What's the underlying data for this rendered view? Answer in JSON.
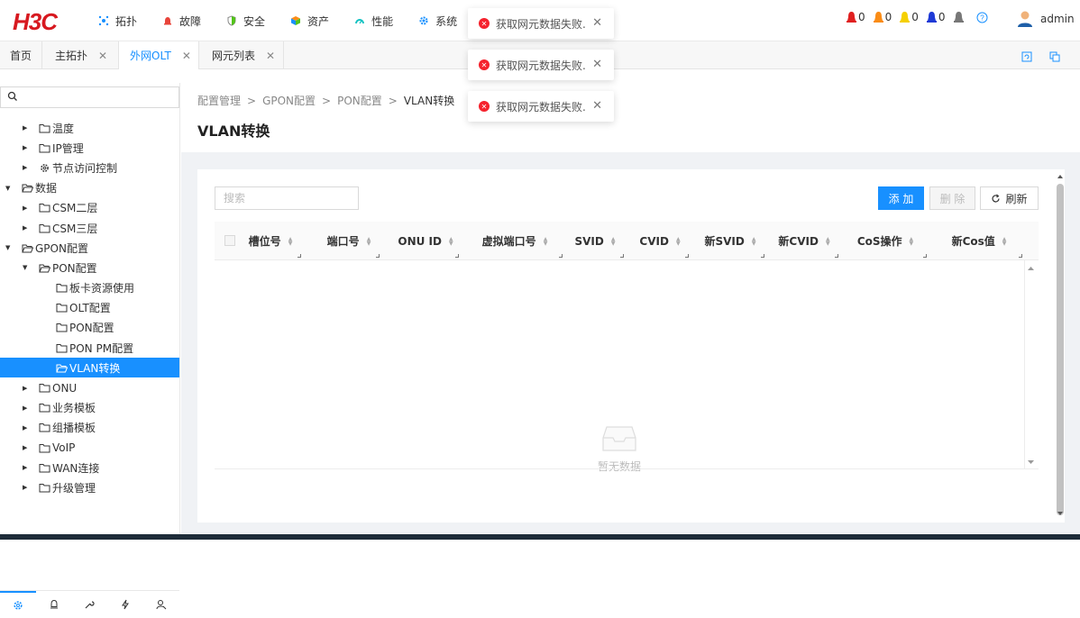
{
  "app": {
    "logo": "H3C",
    "user": "admin"
  },
  "nav": [
    {
      "label": "拓扑",
      "icon": "topology-icon",
      "color": "#1890ff"
    },
    {
      "label": "故障",
      "icon": "fault-icon",
      "color": "#e8443a"
    },
    {
      "label": "安全",
      "icon": "security-icon",
      "color": "#52c41a"
    },
    {
      "label": "资产",
      "icon": "asset-icon",
      "color": "#fa8c16"
    },
    {
      "label": "性能",
      "icon": "performance-icon",
      "color": "#13c2c2"
    },
    {
      "label": "系统",
      "icon": "system-icon",
      "color": "#1890ff"
    }
  ],
  "alarms": [
    {
      "count": "0",
      "color": "#e02020",
      "icon": "alarm-critical-icon"
    },
    {
      "count": "0",
      "color": "#fa8c16",
      "icon": "alarm-major-icon"
    },
    {
      "count": "0",
      "color": "#f5d000",
      "icon": "alarm-minor-icon"
    },
    {
      "count": "0",
      "color": "#1e3ad6",
      "icon": "alarm-warning-icon"
    }
  ],
  "tabs": [
    {
      "label": "首页",
      "closable": false
    },
    {
      "label": "主拓扑",
      "closable": true
    },
    {
      "label": "外网OLT",
      "closable": true,
      "active": true
    },
    {
      "label": "网元列表",
      "closable": true
    }
  ],
  "sidebar": {
    "search_placeholder": "",
    "tree": [
      {
        "label": "温度",
        "level": 1,
        "expanded": false,
        "icon": "folder-icon"
      },
      {
        "label": "IP管理",
        "level": 1,
        "expanded": false,
        "icon": "folder-icon"
      },
      {
        "label": "节点访问控制",
        "level": 1,
        "expanded": false,
        "icon": "gear-icon"
      },
      {
        "label": "数据",
        "level": 0,
        "expanded": true,
        "icon": "folder-open-icon"
      },
      {
        "label": "CSM二层",
        "level": 1,
        "expanded": false,
        "icon": "folder-icon"
      },
      {
        "label": "CSM三层",
        "level": 1,
        "expanded": false,
        "icon": "folder-icon"
      },
      {
        "label": "GPON配置",
        "level": 0,
        "expanded": true,
        "icon": "folder-open-icon"
      },
      {
        "label": "PON配置",
        "level": 1,
        "expanded": true,
        "icon": "folder-open-icon"
      },
      {
        "label": "板卡资源使用",
        "level": 2,
        "leaf": true,
        "icon": "folder-icon"
      },
      {
        "label": "OLT配置",
        "level": 2,
        "leaf": true,
        "icon": "folder-icon"
      },
      {
        "label": "PON配置",
        "level": 2,
        "leaf": true,
        "icon": "folder-icon"
      },
      {
        "label": "PON PM配置",
        "level": 2,
        "leaf": true,
        "icon": "folder-icon"
      },
      {
        "label": "VLAN转换",
        "level": 2,
        "leaf": true,
        "selected": true,
        "icon": "folder-open-icon"
      },
      {
        "label": "ONU",
        "level": 1,
        "expanded": false,
        "icon": "folder-icon"
      },
      {
        "label": "业务模板",
        "level": 1,
        "expanded": false,
        "icon": "folder-icon"
      },
      {
        "label": "组播模板",
        "level": 1,
        "expanded": false,
        "icon": "folder-icon"
      },
      {
        "label": "VoIP",
        "level": 1,
        "expanded": false,
        "icon": "folder-icon"
      },
      {
        "label": "WAN连接",
        "level": 1,
        "expanded": false,
        "icon": "folder-icon"
      },
      {
        "label": "升级管理",
        "level": 1,
        "expanded": false,
        "icon": "folder-icon"
      }
    ],
    "bottom_icons": [
      "config-icon",
      "alarm-bell-icon",
      "tool-icon",
      "lightning-icon",
      "user-search-icon"
    ]
  },
  "breadcrumb": [
    "配置管理",
    "GPON配置",
    "PON配置",
    "VLAN转换"
  ],
  "breadcrumb_sep": ">",
  "page_title": "VLAN转换",
  "toolbar": {
    "search_placeholder": "搜索",
    "add_label": "添 加",
    "delete_label": "删 除",
    "refresh_label": "刷新"
  },
  "table": {
    "columns": [
      "槽位号",
      "端口号",
      "ONU ID",
      "虚拟端口号",
      "SVID",
      "CVID",
      "新SVID",
      "新CVID",
      "CoS操作",
      "新Cos值"
    ],
    "rows": [],
    "empty_text": "暂无数据"
  },
  "toasts": [
    {
      "message": "获取网元数据失败."
    },
    {
      "message": "获取网元数据失败."
    },
    {
      "message": "获取网元数据失败."
    }
  ],
  "colors": {
    "accent": "#1890ff",
    "logo": "#d71920",
    "error": "#f5222d"
  }
}
